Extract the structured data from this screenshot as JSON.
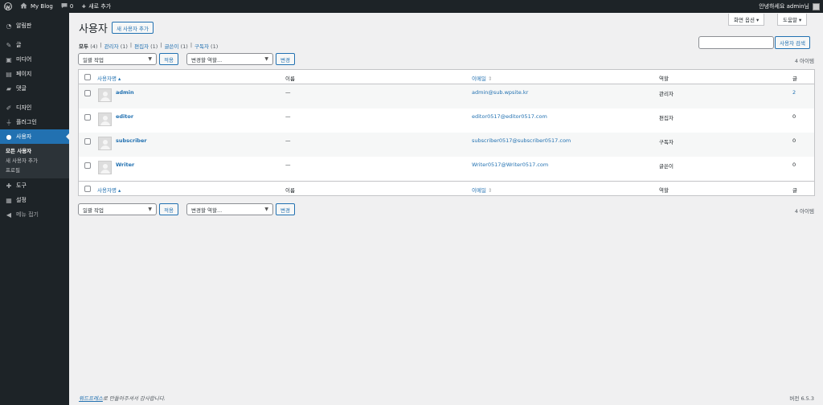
{
  "adminbar": {
    "wp_icon": "wordpress-icon",
    "site_name": "My Blog",
    "comments_count": "0",
    "new_label": "새로 추가",
    "greeting": "안녕하세요 admin님"
  },
  "sidebar": {
    "items": [
      {
        "label": "알림판",
        "icon": "dashboard-icon"
      },
      {
        "label": "글",
        "icon": "pin-icon"
      },
      {
        "label": "미디어",
        "icon": "media-icon"
      },
      {
        "label": "페이지",
        "icon": "page-icon"
      },
      {
        "label": "댓글",
        "icon": "comment-icon"
      },
      {
        "label": "디자인",
        "icon": "brush-icon"
      },
      {
        "label": "플러그인",
        "icon": "plugin-icon"
      },
      {
        "label": "사용자",
        "icon": "user-icon"
      },
      {
        "label": "도구",
        "icon": "wrench-icon"
      },
      {
        "label": "설정",
        "icon": "settings-icon"
      },
      {
        "label": "메뉴 접기",
        "icon": "collapse-icon"
      }
    ],
    "submenu": [
      "모든 사용자",
      "새 사용자 추가",
      "프로필"
    ]
  },
  "header": {
    "screen_options": "화면 옵션 ▾",
    "help": "도움말 ▾",
    "title": "사용자",
    "add_new": "새 사용자 추가"
  },
  "filters": {
    "all": "모두",
    "all_count": "(4)",
    "admin": "관리자",
    "admin_count": "(1)",
    "editor": "편집자",
    "editor_count": "(1)",
    "author": "글쓴이",
    "author_count": "(1)",
    "subscriber": "구독자",
    "subscriber_count": "(1)",
    "sep": "|"
  },
  "search": {
    "button": "사용자 검색",
    "value": ""
  },
  "tablenav": {
    "bulk_action": "일괄 작업",
    "apply": "적용",
    "change_role": "변경할 역할...",
    "change": "변경",
    "items_count": "4 아이템"
  },
  "table": {
    "columns": {
      "username": "사용자명",
      "name": "이름",
      "email": "이메일",
      "role": "역할",
      "posts": "글"
    },
    "rows": [
      {
        "username": "admin",
        "name": "—",
        "email": "admin@sub.wpsite.kr",
        "role": "관리자",
        "posts": "2"
      },
      {
        "username": "editor",
        "name": "—",
        "email": "editor0517@editor0517.com",
        "role": "편집자",
        "posts": "0"
      },
      {
        "username": "subscriber",
        "name": "—",
        "email": "subscriber0517@subscriber0517.com",
        "role": "구독자",
        "posts": "0"
      },
      {
        "username": "Writer",
        "name": "—",
        "email": "Writer0517@Writer0517.com",
        "role": "글쓴이",
        "posts": "0"
      }
    ]
  },
  "footer": {
    "credit_link": "워드프레스",
    "credit_text": "로 만들어주셔서 감사합니다.",
    "version": "버전 6.5.3"
  }
}
